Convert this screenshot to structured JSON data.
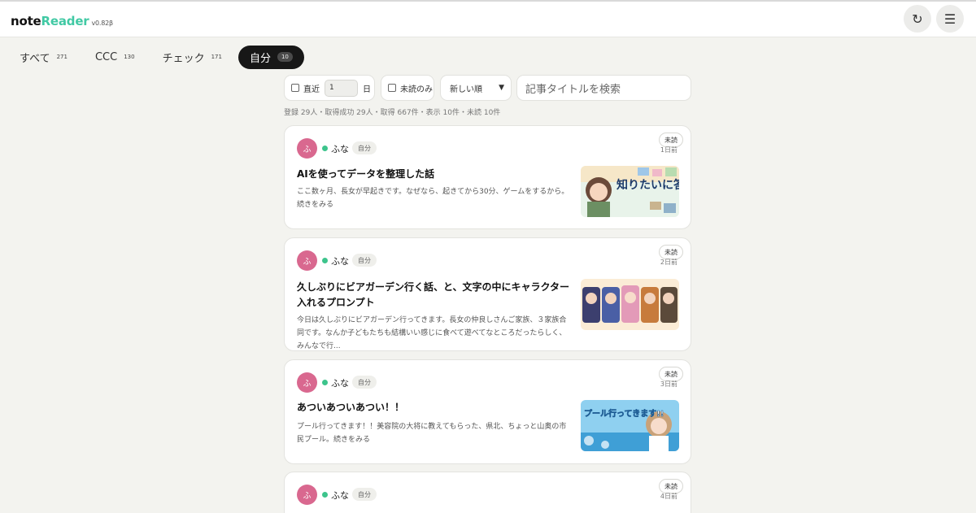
{
  "app": {
    "name_a": "note",
    "name_b": "Reader",
    "version": "v0.82β"
  },
  "header": {
    "refresh_icon": "↻",
    "menu_icon": "☰"
  },
  "tabs": [
    {
      "label": "すべて",
      "count": "271",
      "active": false
    },
    {
      "label": "CCC",
      "count": "130",
      "active": false
    },
    {
      "label": "チェック",
      "count": "171",
      "active": false
    },
    {
      "label": "自分",
      "count": "10",
      "active": true
    }
  ],
  "filters": {
    "recent_label": "直近",
    "recent_days": "1",
    "days_unit": "日",
    "unread_only_label": "未読のみ",
    "sort_selected": "新しい順",
    "search_placeholder": "記事タイトルを検索"
  },
  "stats": "登録 29人・取得成功 29人・取得 667件・表示 10件・未読 10件",
  "articles": [
    {
      "avatar": "ふ",
      "author": "ふな",
      "tag": "自分",
      "badge": "未読",
      "ago": "1日前",
      "title": "AIを使ってデータを整理した話",
      "excerpt": "ここ数ヶ月、長女が早起きです。なぜなら、起きてから30分、ゲームをするから。続きをみる",
      "thumb_text": "知りたいに答える!"
    },
    {
      "avatar": "ふ",
      "author": "ふな",
      "tag": "自分",
      "badge": "未読",
      "ago": "2日前",
      "title": "久しぶりにビアガーデン行く話、と、文字の中にキャラクター入れるプロンプト",
      "excerpt": "今日は久しぶりにビアガーデン行ってきます。長女の仲良しさんご家族、３家族合同です。なんか子どもたちも結構いい感じに食べて遊べてなところだったらしく、みんなで行...",
      "thumb_text": ""
    },
    {
      "avatar": "ふ",
      "author": "ふな",
      "tag": "自分",
      "badge": "未読",
      "ago": "3日前",
      "title": "あついあついあつい！！",
      "excerpt": "プール行ってきます！！美容院の大将に教えてもらった、県北、ちょっと山奥の市民プール。続きをみる",
      "thumb_text": "プール行ってきます!!"
    },
    {
      "avatar": "ふ",
      "author": "ふな",
      "tag": "自分",
      "badge": "未読",
      "ago": "4日前",
      "title": "",
      "excerpt": "",
      "thumb_text": ""
    }
  ],
  "colors": {
    "accent": "#41c9a4",
    "avatar_bg": "#d9688f",
    "online_dot": "#3dc48c",
    "active_tab": "#171717"
  }
}
